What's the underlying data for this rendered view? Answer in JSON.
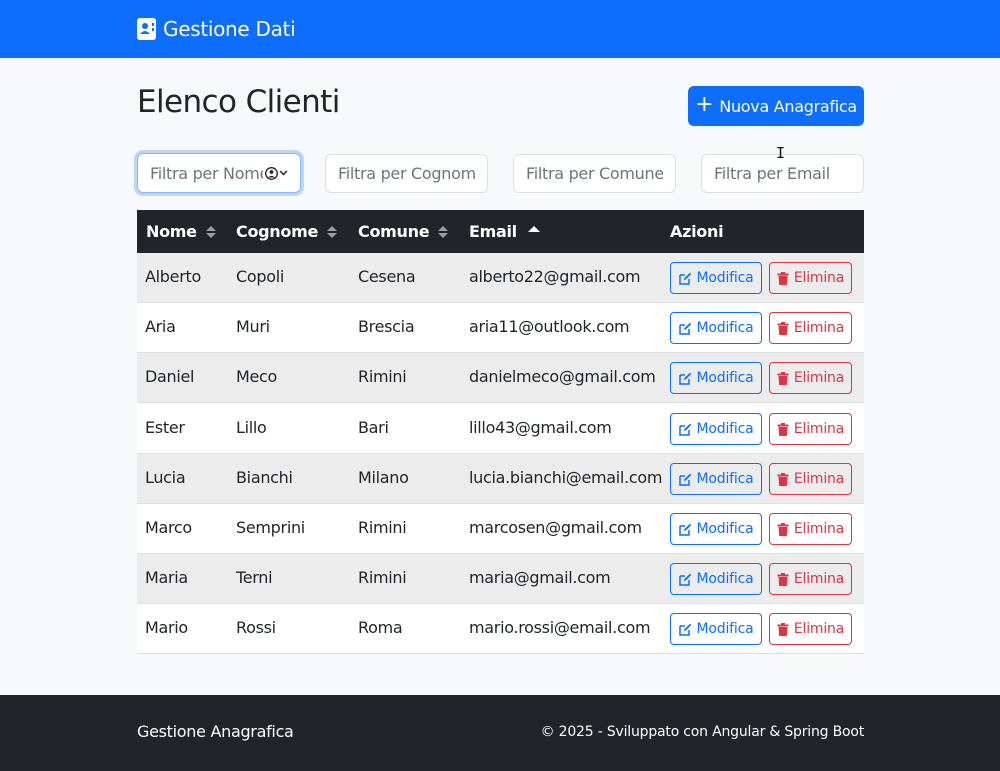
{
  "navbar": {
    "brand": "Gestione Dati",
    "brand_icon": "address-card-icon",
    "color": "#0d6efd"
  },
  "main": {
    "title": "Elenco Clienti",
    "new_button": {
      "icon": "plus-icon",
      "label": "Nuova Anagrafica"
    },
    "filters": [
      {
        "placeholder": "Filtra per Nome",
        "focused": true
      },
      {
        "placeholder": "Filtra per Cognome",
        "focused": false
      },
      {
        "placeholder": "Filtra per Comune",
        "focused": false
      },
      {
        "placeholder": "Filtra per Email",
        "focused": false
      }
    ]
  },
  "table": {
    "columns": [
      {
        "label": "Nome",
        "sort": "none"
      },
      {
        "label": "Cognome",
        "sort": "none"
      },
      {
        "label": "Comune",
        "sort": "none"
      },
      {
        "label": "Email",
        "sort": "asc"
      },
      {
        "label": "Azioni",
        "sort": null
      }
    ],
    "edit_label": "Modifica",
    "delete_label": "Elimina",
    "rows": [
      {
        "nome": "Alberto",
        "cognome": "Copoli",
        "comune": "Cesena",
        "email": "alberto22@gmail.com"
      },
      {
        "nome": "Aria",
        "cognome": "Muri",
        "comune": "Brescia",
        "email": "aria11@outlook.com"
      },
      {
        "nome": "Daniel",
        "cognome": "Meco",
        "comune": "Rimini",
        "email": "danielmeco@gmail.com"
      },
      {
        "nome": "Ester",
        "cognome": "Lillo",
        "comune": "Bari",
        "email": "lillo43@gmail.com"
      },
      {
        "nome": "Lucia",
        "cognome": "Bianchi",
        "comune": "Milano",
        "email": "lucia.bianchi@email.com"
      },
      {
        "nome": "Marco",
        "cognome": "Semprini",
        "comune": "Rimini",
        "email": "marcosen@gmail.com"
      },
      {
        "nome": "Maria",
        "cognome": "Terni",
        "comune": "Rimini",
        "email": "maria@gmail.com"
      },
      {
        "nome": "Mario",
        "cognome": "Rossi",
        "comune": "Roma",
        "email": "mario.rossi@email.com"
      }
    ]
  },
  "footer": {
    "left": "Gestione Anagrafica",
    "right": "© 2025 - Sviluppato con Angular & Spring Boot"
  }
}
